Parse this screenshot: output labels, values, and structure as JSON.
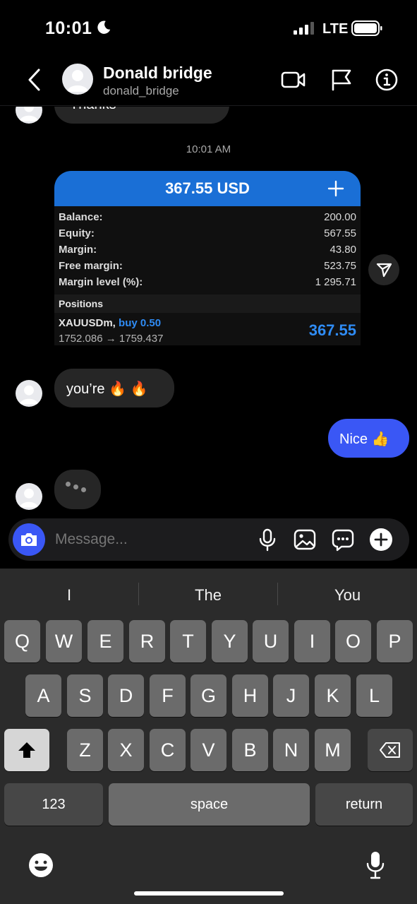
{
  "status_bar": {
    "time": "10:01",
    "network": "LTE"
  },
  "header": {
    "name": "Donald bridge",
    "handle": "donald_bridge"
  },
  "chat": {
    "partial_message": "Thanks",
    "timestamp": "10:01 AM",
    "card": {
      "amount": "367.55 USD",
      "rows": [
        {
          "label": "Balance:",
          "value": "200.00"
        },
        {
          "label": "Equity:",
          "value": "567.55"
        },
        {
          "label": "Margin:",
          "value": "43.80"
        },
        {
          "label": "Free margin:",
          "value": "523.75"
        },
        {
          "label": "Margin level (%):",
          "value": "1 295.71"
        }
      ],
      "positions_label": "Positions",
      "position": {
        "symbol": "XAUUSDm,",
        "side": "buy 0.50",
        "prices": "1752.086 → 1759.437",
        "profit": "367.55"
      }
    },
    "incoming_message": "you’re 🔥 🔥",
    "outgoing_message": "Nice 👍"
  },
  "composer": {
    "placeholder": "Message..."
  },
  "keyboard": {
    "suggestions": [
      "I",
      "The",
      "You"
    ],
    "row1": [
      "Q",
      "W",
      "E",
      "R",
      "T",
      "Y",
      "U",
      "I",
      "O",
      "P"
    ],
    "row2": [
      "A",
      "S",
      "D",
      "F",
      "G",
      "H",
      "J",
      "K",
      "L"
    ],
    "row3": [
      "Z",
      "X",
      "C",
      "V",
      "B",
      "N",
      "M"
    ],
    "numbers_label": "123",
    "space_label": "space",
    "return_label": "return"
  },
  "colors": {
    "accent_blue": "#3a57f5",
    "card_blue": "#1a6fd6",
    "profit_blue": "#2f8cf5"
  }
}
